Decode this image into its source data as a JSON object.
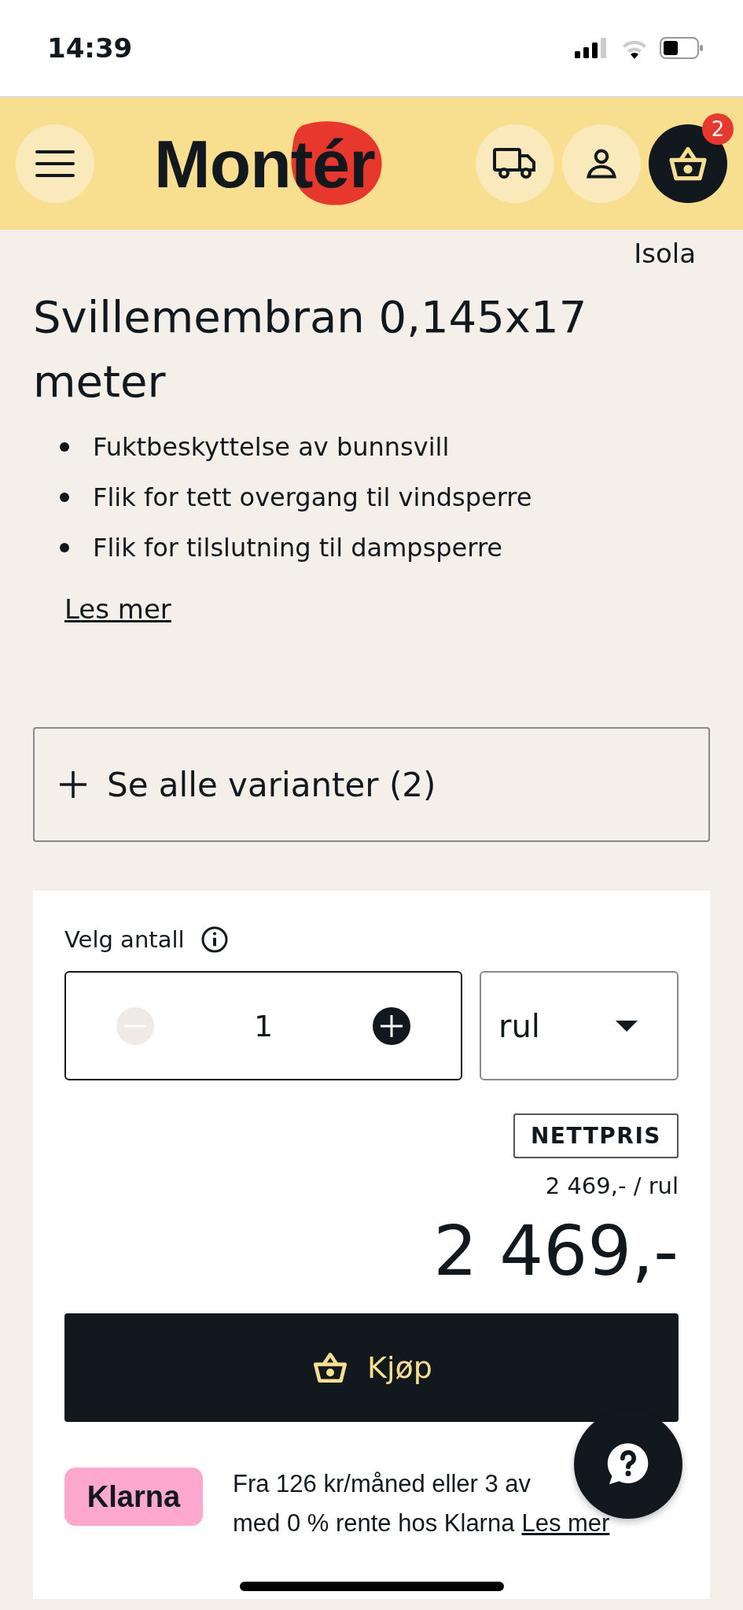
{
  "status_bar": {
    "time": "14:39"
  },
  "header": {
    "logo": "Montér",
    "cart_count": "2"
  },
  "brand": "Isola",
  "title": "Svillemembran 0,145x17 meter",
  "features": [
    "Fuktbeskyttelse av bunnsvill",
    "Flik for tett overgang til vindsperre",
    "Flik for tilslutning til dampsperre"
  ],
  "read_more": "Les mer",
  "variants": {
    "label": "Se alle varianter (2)",
    "expanded": false
  },
  "quantity": {
    "label": "Velg antall",
    "value": "1",
    "decrement_disabled": true,
    "unit": "rul"
  },
  "price": {
    "badge": "NETTPRIS",
    "unit_price": "2 469,- / rul",
    "total": "2 469,-"
  },
  "buy_button": "Kjøp",
  "klarna": {
    "badge": "Klarna",
    "line_1": "Fra 126 kr/måned eller 3 av",
    "line_2": "med 0 % rente hos Klarna",
    "link": "Les mer"
  }
}
